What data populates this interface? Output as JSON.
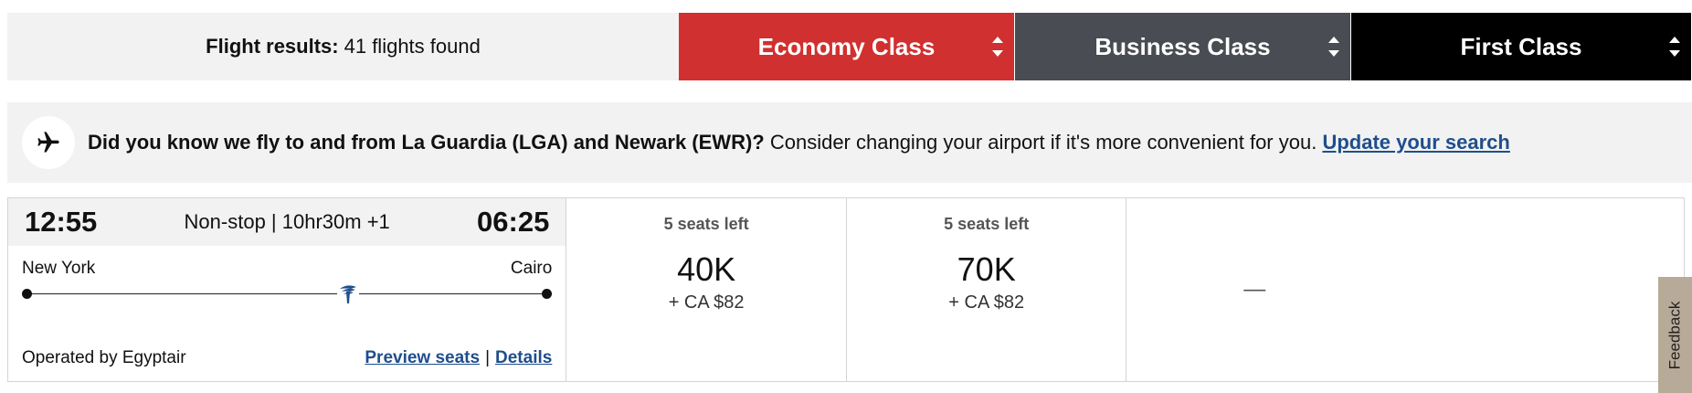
{
  "header": {
    "results_label": "Flight results:",
    "results_count": "41 flights found",
    "tabs": [
      {
        "label": "Economy Class",
        "color": "#d0302f"
      },
      {
        "label": "Business Class",
        "color": "#4a4c53"
      },
      {
        "label": "First Class",
        "color": "#000000"
      }
    ]
  },
  "banner": {
    "icon": "airplane-icon",
    "bold_text": "Did you know we fly to and from La Guardia (LGA) and Newark (EWR)?",
    "body_text": " Consider changing your airport if it's more convenient for you. ",
    "link_text": "Update your search"
  },
  "flight": {
    "departure_time": "12:55",
    "arrival_time": "06:25",
    "trip_meta": "Non-stop | 10hr30m +1",
    "origin": "New York",
    "destination": "Cairo",
    "operated_by": "Operated by Egyptair",
    "preview_seats": "Preview seats",
    "separator": "|",
    "details": "Details",
    "fares": [
      {
        "class": "Economy",
        "seats_left": "5 seats left",
        "points": "40K",
        "fee": "+ CA $82"
      },
      {
        "class": "Business",
        "seats_left": "5 seats left",
        "points": "70K",
        "fee": "+ CA $82"
      },
      {
        "class": "First",
        "unavailable": "—"
      }
    ]
  },
  "feedback": {
    "label": "Feedback"
  }
}
